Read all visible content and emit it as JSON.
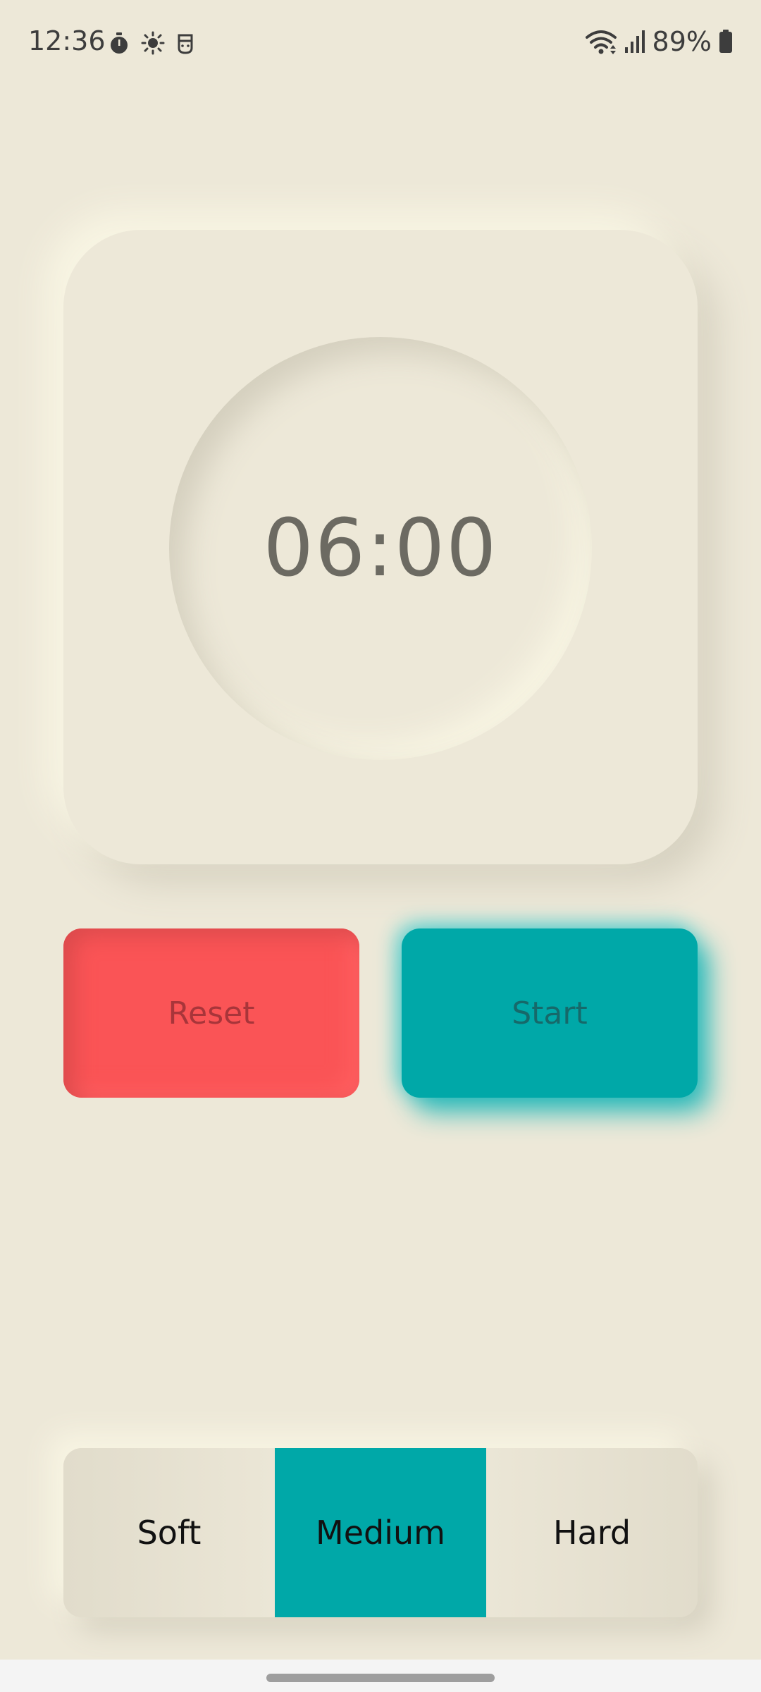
{
  "status_bar": {
    "time": "12:36",
    "battery": "89%",
    "left_icons": [
      "stopwatch-icon",
      "brightness-icon",
      "face-icon"
    ],
    "right_icons": [
      "wifi-icon",
      "signal-icon",
      "battery-icon"
    ]
  },
  "timer": {
    "value": "06:00"
  },
  "buttons": {
    "reset_label": "Reset",
    "start_label": "Start"
  },
  "modes": [
    {
      "label": "Soft",
      "selected": false
    },
    {
      "label": "Medium",
      "selected": true
    },
    {
      "label": "Hard",
      "selected": false
    }
  ],
  "colors": {
    "background": "#ede8d8",
    "accent": "#00a8a8",
    "reset": "#fa5456",
    "timer_text": "#6c6a62"
  }
}
